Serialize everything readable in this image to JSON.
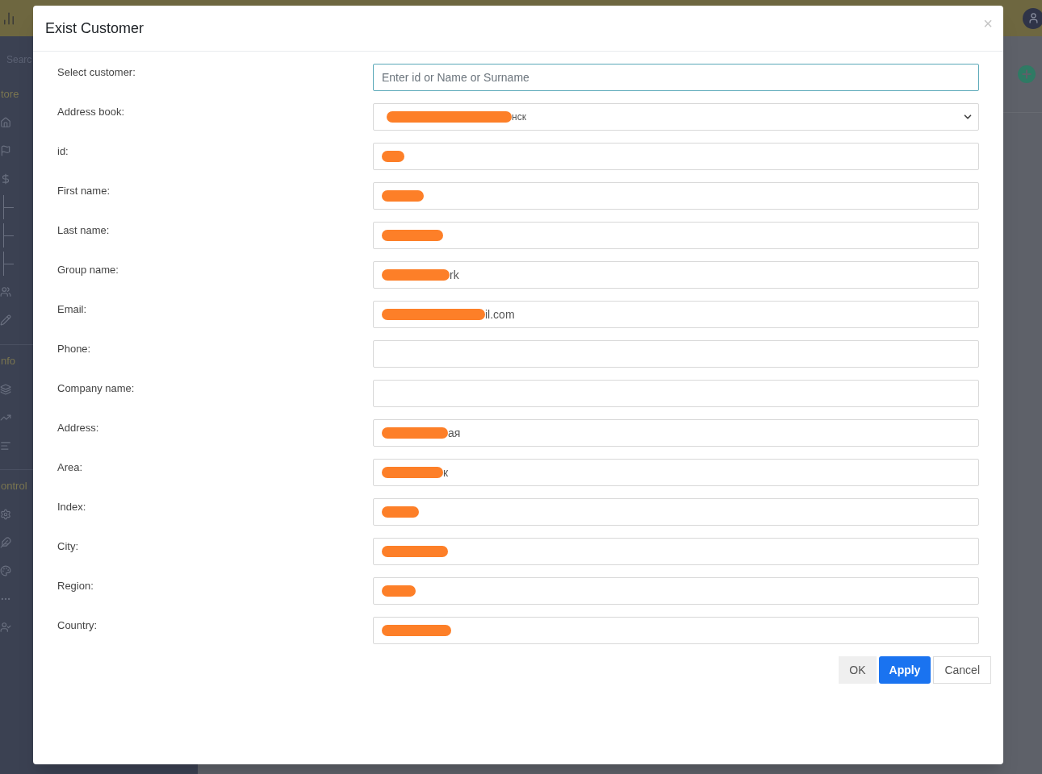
{
  "backdrop": {
    "search": "Searc",
    "sections": [
      {
        "title": "tore",
        "items": [
          {
            "kind": "home"
          },
          {
            "kind": "flag"
          },
          {
            "kind": "dollar"
          },
          {
            "kind": "sub"
          },
          {
            "kind": "sub"
          },
          {
            "kind": "sub"
          },
          {
            "kind": "users"
          },
          {
            "kind": "pen"
          }
        ]
      },
      {
        "title": "nfo",
        "items": [
          {
            "kind": "layers"
          },
          {
            "kind": "chart"
          },
          {
            "kind": "list"
          }
        ]
      },
      {
        "title": "ontrol",
        "items": [
          {
            "kind": "gear"
          },
          {
            "kind": "leaf"
          },
          {
            "kind": "palette"
          },
          {
            "kind": "dots"
          },
          {
            "kind": "people"
          }
        ]
      }
    ]
  },
  "dialog": {
    "title": "Exist Customer",
    "close": "×",
    "fields": [
      {
        "label": "Select customer:",
        "kind": "text",
        "placeholder": "Enter id or Name or Surname",
        "focused": true,
        "redacted": false
      },
      {
        "label": "Address book:",
        "kind": "select",
        "value": "нск",
        "focused": false,
        "redacted": true
      },
      {
        "label": "id:",
        "kind": "text",
        "focused": false,
        "redacted": true
      },
      {
        "label": "First name:",
        "kind": "text",
        "focused": false,
        "redacted": true
      },
      {
        "label": "Last name:",
        "kind": "text",
        "focused": false,
        "redacted": true
      },
      {
        "label": "Group name:",
        "kind": "text",
        "value": "rk",
        "focused": false,
        "redacted": true
      },
      {
        "label": "Email:",
        "kind": "text",
        "value": "il.com",
        "focused": false,
        "redacted": true
      },
      {
        "label": "Phone:",
        "kind": "text",
        "focused": false,
        "redacted": false
      },
      {
        "label": "Company name:",
        "kind": "text",
        "focused": false,
        "redacted": false
      },
      {
        "label": "Address:",
        "kind": "text",
        "value": "ая",
        "focused": false,
        "redacted": true
      },
      {
        "label": "Area:",
        "kind": "text",
        "value": "к",
        "focused": false,
        "redacted": true
      },
      {
        "label": "Index:",
        "kind": "text",
        "focused": false,
        "redacted": true
      },
      {
        "label": "City:",
        "kind": "text",
        "focused": false,
        "redacted": true
      },
      {
        "label": "Region:",
        "kind": "text",
        "focused": false,
        "redacted": true
      },
      {
        "label": "Country:",
        "kind": "text",
        "focused": false,
        "redacted": true
      }
    ],
    "buttons": [
      {
        "label": "OK",
        "kind": "secondary"
      },
      {
        "label": "Apply",
        "kind": "primary"
      },
      {
        "label": "Cancel",
        "kind": "outline"
      }
    ]
  }
}
